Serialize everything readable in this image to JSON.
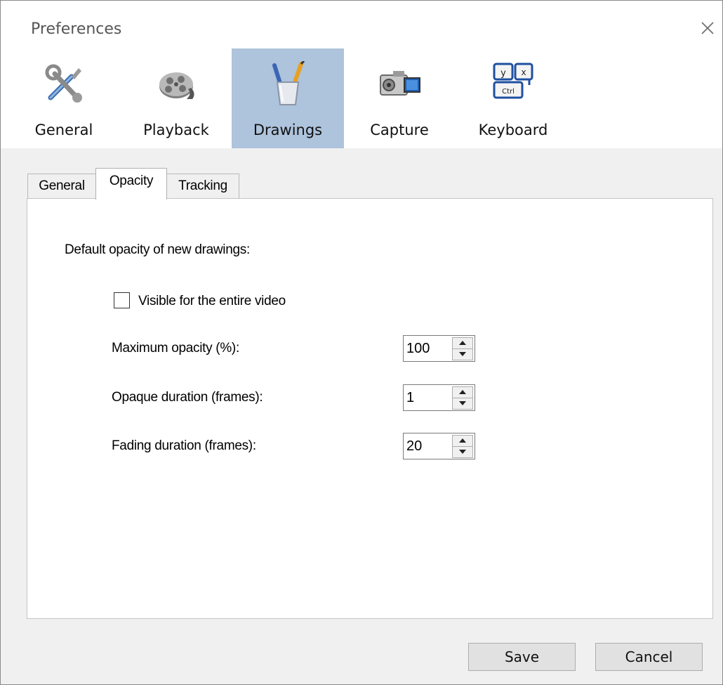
{
  "window": {
    "title": "Preferences"
  },
  "categories": [
    {
      "label": "General",
      "icon": "tools-icon"
    },
    {
      "label": "Playback",
      "icon": "film-reel-icon"
    },
    {
      "label": "Drawings",
      "icon": "pencil-cup-icon",
      "active": true
    },
    {
      "label": "Capture",
      "icon": "camera-icon"
    },
    {
      "label": "Keyboard",
      "icon": "keyboard-keys-icon"
    }
  ],
  "tabs": [
    {
      "label": "General"
    },
    {
      "label": "Opacity",
      "active": true
    },
    {
      "label": "Tracking"
    }
  ],
  "opacity": {
    "heading": "Default opacity of new drawings:",
    "visible_checkbox": {
      "label": "Visible for the entire video",
      "checked": false
    },
    "max_opacity": {
      "label": "Maximum opacity (%):",
      "value": "100"
    },
    "opaque_duration": {
      "label": "Opaque duration (frames):",
      "value": "1"
    },
    "fading_duration": {
      "label": "Fading duration (frames):",
      "value": "20"
    }
  },
  "buttons": {
    "save": "Save",
    "cancel": "Cancel"
  },
  "colors": {
    "active_category_bg": "#aec3dc",
    "window_bg": "#f0f0f0"
  }
}
